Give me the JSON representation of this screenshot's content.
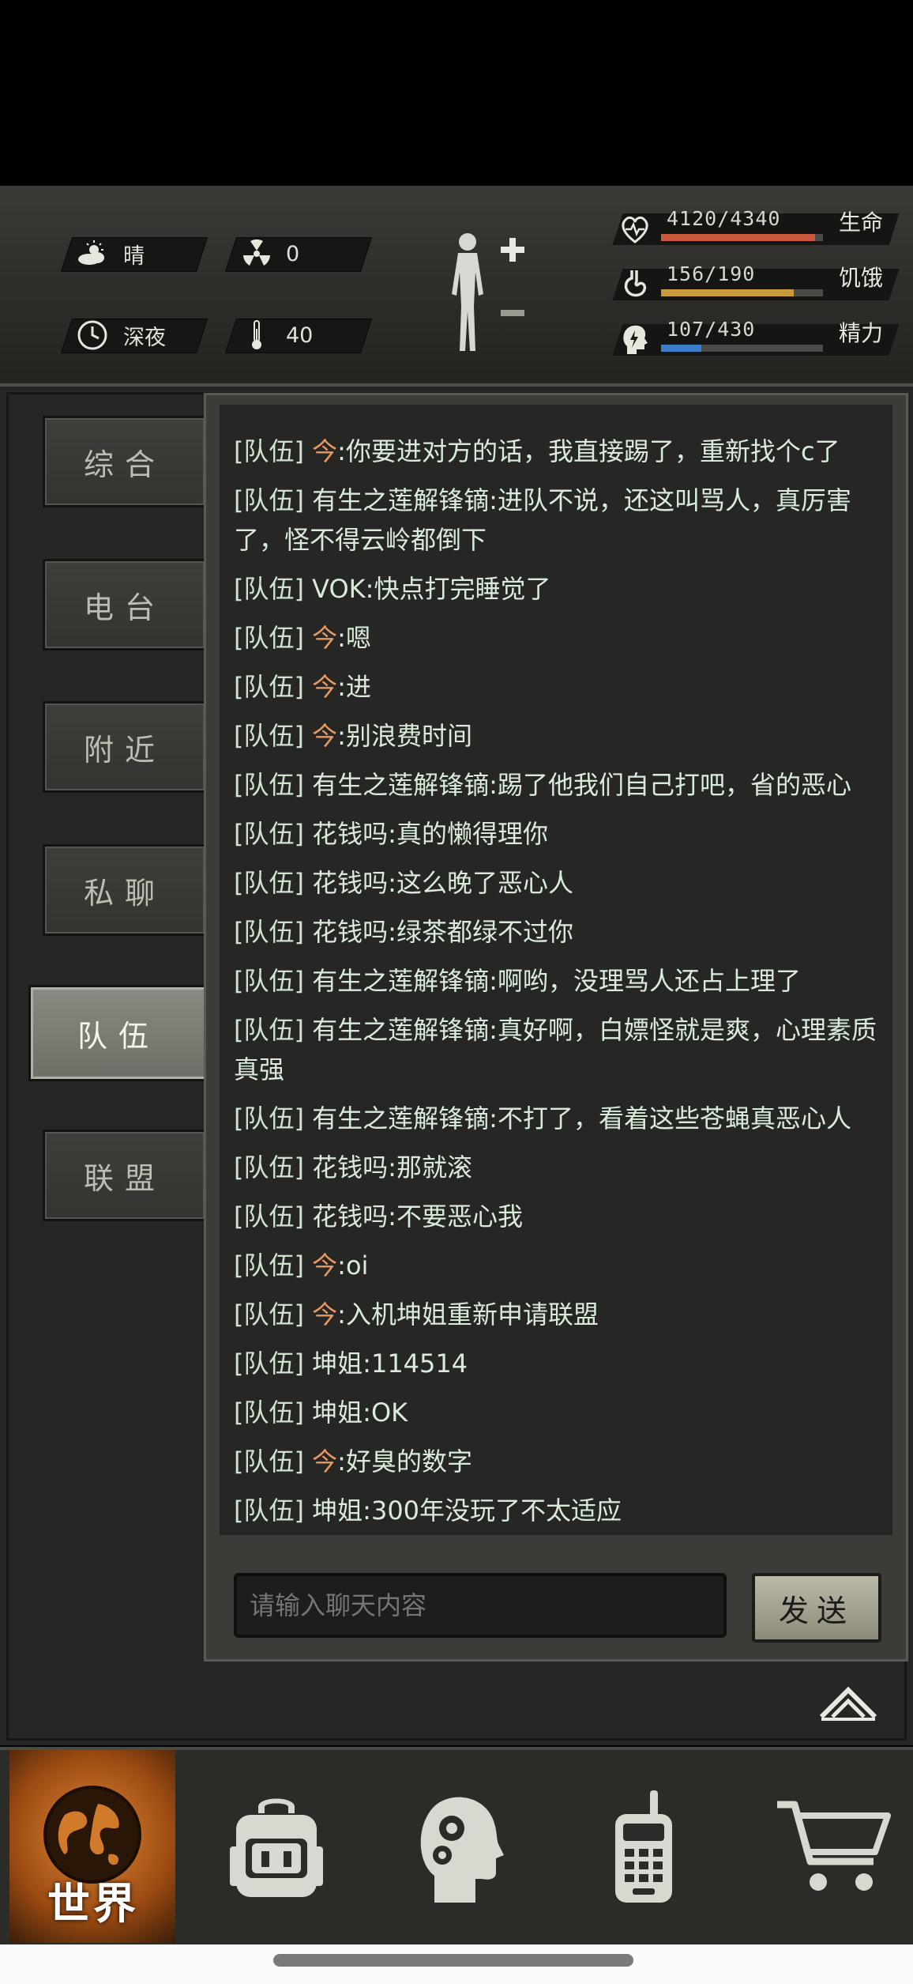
{
  "status": {
    "weather": "晴",
    "radiation": "0",
    "time_of_day": "深夜",
    "temperature": "40"
  },
  "stats": {
    "health": {
      "value": "4120/4340",
      "label": "生命",
      "fraction": 0.949,
      "color": "#c9583c"
    },
    "hunger": {
      "value": "156/190",
      "label": "饥饿",
      "fraction": 0.821,
      "color": "#c99a3c"
    },
    "energy": {
      "value": "107/430",
      "label": "精力",
      "fraction": 0.249,
      "color": "#3c7ec9"
    }
  },
  "tabs": [
    {
      "label": "综合",
      "active": false
    },
    {
      "label": "电台",
      "active": false
    },
    {
      "label": "附近",
      "active": false
    },
    {
      "label": "私聊",
      "active": false
    },
    {
      "label": "队伍",
      "active": true
    },
    {
      "label": "联盟",
      "active": false
    }
  ],
  "messages": [
    {
      "channel": "[队伍]",
      "name": "今",
      "self": true,
      "text": ":你要进对方的话，我直接踢了，重新找个c了"
    },
    {
      "channel": "[队伍]",
      "name": "有生之莲解锋镝",
      "self": false,
      "text": ":进队不说，还这叫骂人，真厉害了，怪不得云岭都倒下"
    },
    {
      "channel": "[队伍]",
      "name": "VOK",
      "self": false,
      "text": ":快点打完睡觉了"
    },
    {
      "channel": "[队伍]",
      "name": "今",
      "self": true,
      "text": ":嗯"
    },
    {
      "channel": "[队伍]",
      "name": "今",
      "self": true,
      "text": ":进"
    },
    {
      "channel": "[队伍]",
      "name": "今",
      "self": true,
      "text": ":别浪费时间"
    },
    {
      "channel": "[队伍]",
      "name": "有生之莲解锋镝",
      "self": false,
      "text": ":踢了他我们自己打吧，省的恶心"
    },
    {
      "channel": "[队伍]",
      "name": "花钱吗",
      "self": false,
      "text": ":真的懒得理你"
    },
    {
      "channel": "[队伍]",
      "name": "花钱吗",
      "self": false,
      "text": ":这么晚了恶心人"
    },
    {
      "channel": "[队伍]",
      "name": "花钱吗",
      "self": false,
      "text": ":绿茶都绿不过你"
    },
    {
      "channel": "[队伍]",
      "name": "有生之莲解锋镝",
      "self": false,
      "text": ":啊哟，没理骂人还占上理了"
    },
    {
      "channel": "[队伍]",
      "name": "有生之莲解锋镝",
      "self": false,
      "text": ":真好啊，白嫖怪就是爽，心理素质真强"
    },
    {
      "channel": "[队伍]",
      "name": "有生之莲解锋镝",
      "self": false,
      "text": ":不打了，看着这些苍蝇真恶心人"
    },
    {
      "channel": "[队伍]",
      "name": "花钱吗",
      "self": false,
      "text": ":那就滚"
    },
    {
      "channel": "[队伍]",
      "name": "花钱吗",
      "self": false,
      "text": ":不要恶心我"
    },
    {
      "channel": "[队伍]",
      "name": "今",
      "self": true,
      "text": ":oi"
    },
    {
      "channel": "[队伍]",
      "name": "今",
      "self": true,
      "text": ":入机坤姐重新申请联盟"
    },
    {
      "channel": "[队伍]",
      "name": "坤姐",
      "self": false,
      "text": ":114514"
    },
    {
      "channel": "[队伍]",
      "name": "坤姐",
      "self": false,
      "text": ":OK"
    },
    {
      "channel": "[队伍]",
      "name": "今",
      "self": true,
      "text": ":好臭的数字"
    },
    {
      "channel": "[队伍]",
      "name": "坤姐",
      "self": false,
      "text": ":300年没玩了不太适应"
    }
  ],
  "chat_input": {
    "placeholder": "请输入聊天内容"
  },
  "send_label": "发送",
  "bottom_nav": {
    "world_label": "世界",
    "items": [
      "globe-icon",
      "backpack-icon",
      "skills-head-icon",
      "radio-icon",
      "cart-icon"
    ]
  }
}
